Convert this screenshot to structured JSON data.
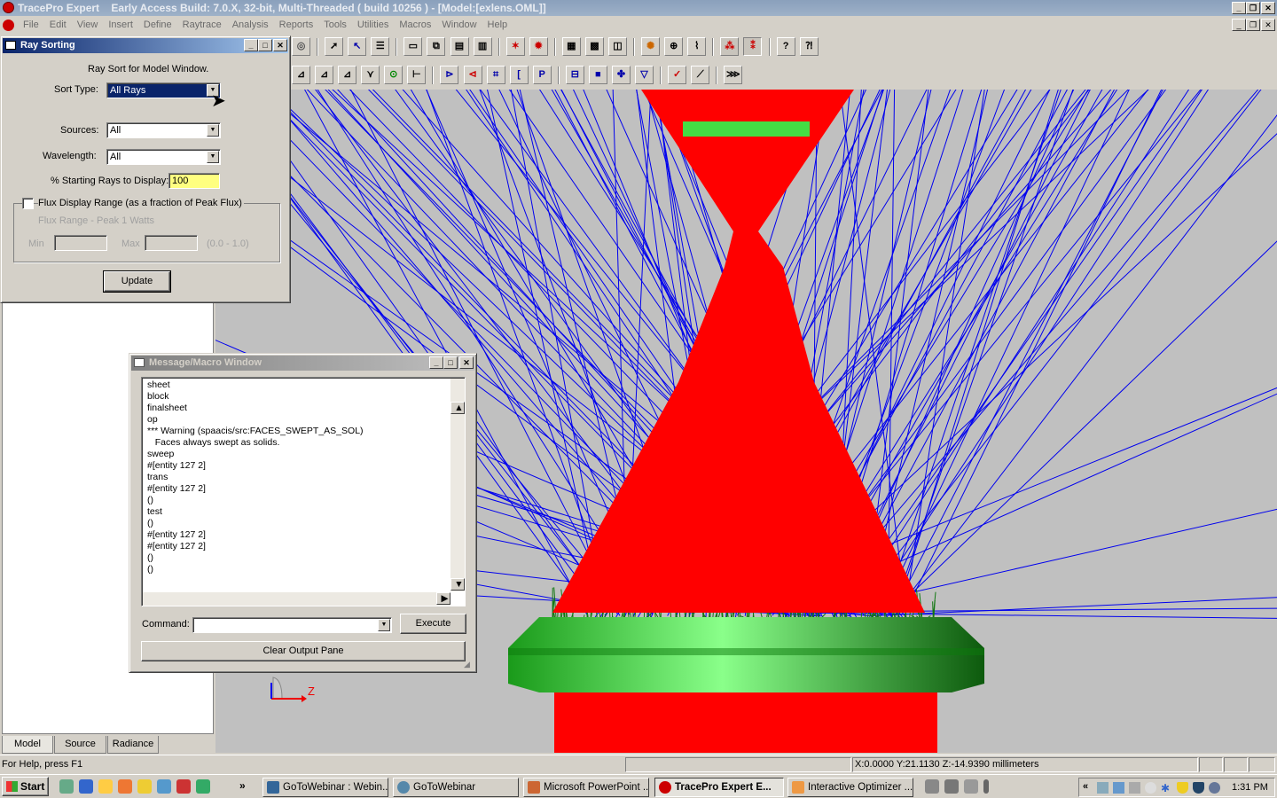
{
  "app": {
    "title_prefix": "TracePro Expert",
    "title_rest": "Early Access Build: 7.0.X, 32-bit, Multi-Threaded    ( build 10256 ) - [Model:[exlens.OML]]"
  },
  "menu": [
    "File",
    "Edit",
    "View",
    "Insert",
    "Define",
    "Raytrace",
    "Analysis",
    "Reports",
    "Tools",
    "Utilities",
    "Macros",
    "Window",
    "Help"
  ],
  "ray_sorting": {
    "title": "Ray Sorting",
    "heading": "Ray Sort for Model Window.",
    "sort_type_label": "Sort Type:",
    "sort_type_value": "All Rays",
    "sources_label": "Sources:",
    "sources_value": "All",
    "wavelength_label": "Wavelength:",
    "wavelength_value": "All",
    "starting_rays_label": "% Starting Rays to Display:",
    "starting_rays_value": "100",
    "flux_checkbox_label": "Flux Display Range (as a fraction of Peak Flux)",
    "flux_range_label": "Flux Range - Peak 1 Watts",
    "min_label": "Min",
    "max_label": "Max",
    "range_hint": "(0.0 - 1.0)",
    "update_button": "Update"
  },
  "message_window": {
    "title": "Message/Macro Window",
    "lines": [
      "sheet",
      "block",
      "finalsheet",
      "op",
      "*** Warning (spaacis/src:FACES_SWEPT_AS_SOL)",
      "   Faces always swept as solids.",
      "sweep",
      "#[entity 127 2]",
      "trans",
      "#[entity 127 2]",
      "()",
      "test",
      "()",
      "#[entity 127 2]",
      "#[entity 127 2]",
      "()",
      "()"
    ],
    "command_label": "Command:",
    "execute_button": "Execute",
    "clear_button": "Clear Output Pane"
  },
  "tabs": [
    "Model",
    "Source",
    "Radiance"
  ],
  "axis_label": "Z",
  "status": {
    "help": "For Help, press F1",
    "coords": "X:0.0000 Y:21.1130 Z:-14.9390 millimeters"
  },
  "taskbar": {
    "start": "Start",
    "tasks": [
      "GoToWebinar : Webin...",
      "GoToWebinar",
      "Microsoft PowerPoint ...",
      "TracePro Expert    E...",
      "Interactive Optimizer ..."
    ],
    "clock": "1:31 PM"
  },
  "colors": {
    "ray_red": "#ff0000",
    "ray_blue": "#0000ee",
    "lens_green": "#22cc22",
    "viewport_bg": "#c0c0c0"
  }
}
